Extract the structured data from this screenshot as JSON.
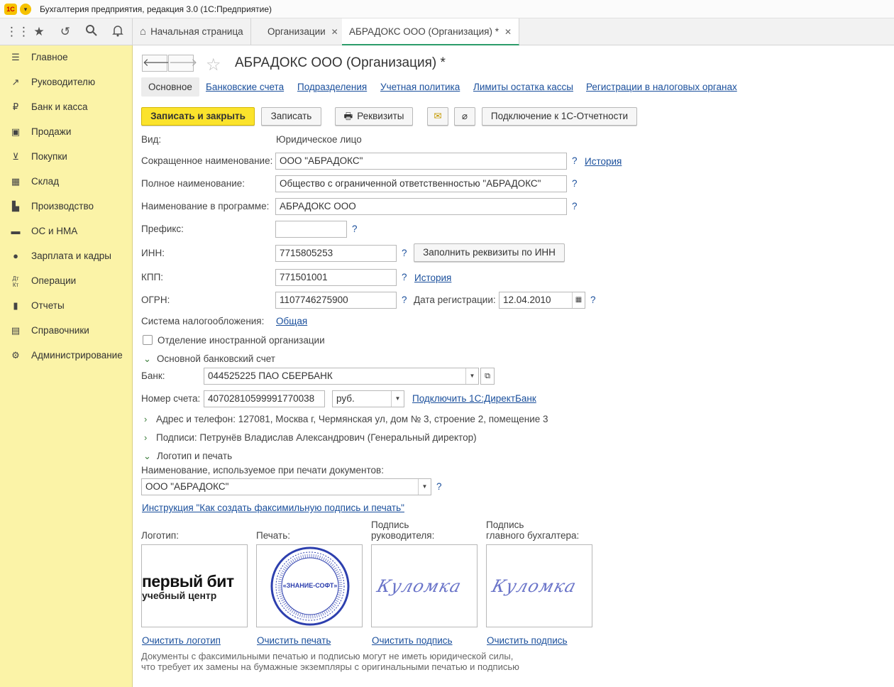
{
  "window": {
    "title": "Бухгалтерия предприятия, редакция 3.0   (1С:Предприятие)",
    "logo_text": "1С"
  },
  "tabs": [
    {
      "label": "Начальная страница"
    },
    {
      "label": "Организации"
    },
    {
      "label": "АБРАДОКС ООО (Организация) *"
    }
  ],
  "sidebar": {
    "items": [
      {
        "label": "Главное",
        "icon": "menu-icon"
      },
      {
        "label": "Руководителю",
        "icon": "trend-icon"
      },
      {
        "label": "Банк и касса",
        "icon": "ruble-icon"
      },
      {
        "label": "Продажи",
        "icon": "bag-icon"
      },
      {
        "label": "Покупки",
        "icon": "cart-icon"
      },
      {
        "label": "Склад",
        "icon": "grid-icon"
      },
      {
        "label": "Производство",
        "icon": "factory-icon"
      },
      {
        "label": "ОС и НМА",
        "icon": "truck-icon"
      },
      {
        "label": "Зарплата и кадры",
        "icon": "person-icon"
      },
      {
        "label": "Операции",
        "icon": "dt-kt-icon"
      },
      {
        "label": "Отчеты",
        "icon": "bar-chart-icon"
      },
      {
        "label": "Справочники",
        "icon": "book-icon"
      },
      {
        "label": "Администрирование",
        "icon": "gear-icon"
      }
    ]
  },
  "page": {
    "title": "АБРАДОКС ООО (Организация) *"
  },
  "subtabs": {
    "current": "Основное",
    "links": [
      "Банковские счета",
      "Подразделения",
      "Учетная политика",
      "Лимиты остатка кассы",
      "Регистрации в налоговых органах"
    ]
  },
  "actions": {
    "save_close": "Записать и закрыть",
    "save": "Записать",
    "requisites": "Реквизиты",
    "connect": "Подключение к 1С-Отчетности"
  },
  "form": {
    "kind_label": "Вид:",
    "kind_value": "Юридическое лицо",
    "short_name_label": "Сокращенное наименование:",
    "short_name": "ООО \"АБРАДОКС\"",
    "history": "История",
    "full_name_label": "Полное наименование:",
    "full_name": "Общество с ограниченной ответственностью \"АБРАДОКС\"",
    "program_name_label": "Наименование в программе:",
    "program_name": "АБРАДОКС ООО",
    "prefix_label": "Префикс:",
    "prefix": "",
    "inn_label": "ИНН:",
    "inn": "7715805253",
    "fill_by_inn": "Заполнить реквизиты по ИНН",
    "kpp_label": "КПП:",
    "kpp": "771501001",
    "kpp_history": "История",
    "ogrn_label": "ОГРН:",
    "ogrn": "1107746275900",
    "reg_date_label": "Дата регистрации:",
    "reg_date": "12.04.2010",
    "tax_label": "Система налогообложения:",
    "tax_value": "Общая",
    "foreign_label": "Отделение иностранной организации",
    "bank_section": "Основной банковский счет",
    "bank_label": "Банк:",
    "bank_value": "044525225 ПАО СБЕРБАНК",
    "account_label": "Номер счета:",
    "account_value": "40702810599991770038",
    "currency": "руб.",
    "directbank": "Подключить 1С:ДиректБанк",
    "address": "Адрес и телефон: 127081, Москва г, Чермянская ул, дом № 3, строение 2, помещение 3",
    "signatures": "Подписи: Петрунёв Владислав Александрович (Генеральный директор)",
    "logo_section": "Логотип и печать",
    "print_name_label": "Наименование, используемое при печати документов:",
    "print_name": "ООО \"АБРАДОКС\"",
    "instruction": "Инструкция \"Как создать факсимильную подпись и печать\"",
    "logo_label": "Логотип:",
    "stamp_label": "Печать:",
    "head_sign_label_1": "Подпись",
    "head_sign_label_2": "руководителя:",
    "acc_sign_label_1": "Подпись",
    "acc_sign_label_2": "главного бухгалтера:",
    "clear_logo": "Очистить логотип",
    "clear_stamp": "Очистить печать",
    "clear_sign1": "Очистить подпись",
    "clear_sign2": "Очистить подпись",
    "note1": "Документы с факсимильными печатью и подписью могут не иметь юридической силы,",
    "note2": "что требует их замены на бумажные экземпляры с оригинальными печатью и подписью"
  },
  "images": {
    "logo_text_1": "первый бит",
    "logo_text_2": "учебный центр",
    "stamp_text": "«ЗНАНИЕ-СОФТ»",
    "signature_text": "Куломка"
  }
}
